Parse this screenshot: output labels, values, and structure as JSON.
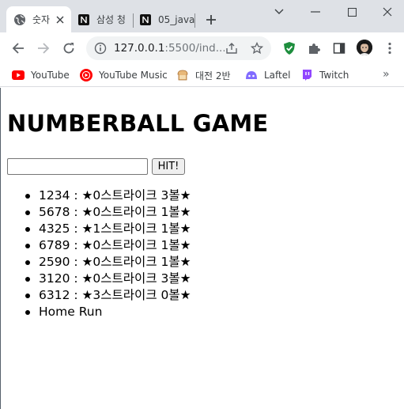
{
  "browser": {
    "tabs": [
      {
        "title": "숫자",
        "icon": "globe-icon",
        "active": true
      },
      {
        "title": "삼성 청",
        "icon": "notion-icon",
        "active": false
      },
      {
        "title": "05_java",
        "icon": "notion-icon",
        "active": false
      }
    ],
    "new_tab_label": "+",
    "window_controls": [
      "minimize-icon",
      "maximize-icon",
      "close-icon"
    ]
  },
  "toolbar": {
    "url_host": "127.0.0.1",
    "url_rest": ":5500/ind...",
    "icons": [
      "back-icon",
      "forward-icon",
      "reload-icon",
      "info-icon",
      "share-icon",
      "bookmark-star-icon",
      "shield-extension-icon",
      "puzzle-extension-icon",
      "side-panel-icon",
      "profile-avatar",
      "more-menu-icon"
    ]
  },
  "bookmarks": [
    {
      "label": "YouTube",
      "icon": "youtube-icon"
    },
    {
      "label": "YouTube Music",
      "icon": "youtube-music-icon"
    },
    {
      "label": "대전 2반",
      "icon": "bread-icon"
    },
    {
      "label": "Laftel",
      "icon": "laftel-icon"
    },
    {
      "label": "Twitch",
      "icon": "twitch-icon"
    }
  ],
  "bookmarks_more": "»",
  "page": {
    "title": "NUMBERBALL GAME",
    "input_value": "",
    "hit_label": "HIT!",
    "results": [
      "1234 : ★0스트라이크 3볼★",
      "5678 : ★0스트라이크 1볼★",
      "4325 : ★1스트라이크 1볼★",
      "6789 : ★0스트라이크 1볼★",
      "2590 : ★0스트라이크 1볼★",
      "3120 : ★0스트라이크 3볼★",
      "6312 : ★3스트라이크 0볼★",
      "Home Run"
    ]
  },
  "colors": {
    "tabstrip": "#dee1e6",
    "youtube_red": "#ff0000",
    "shield_green": "#1e8e3e",
    "laftel_purple": "#816bff",
    "twitch_purple": "#9146ff"
  }
}
